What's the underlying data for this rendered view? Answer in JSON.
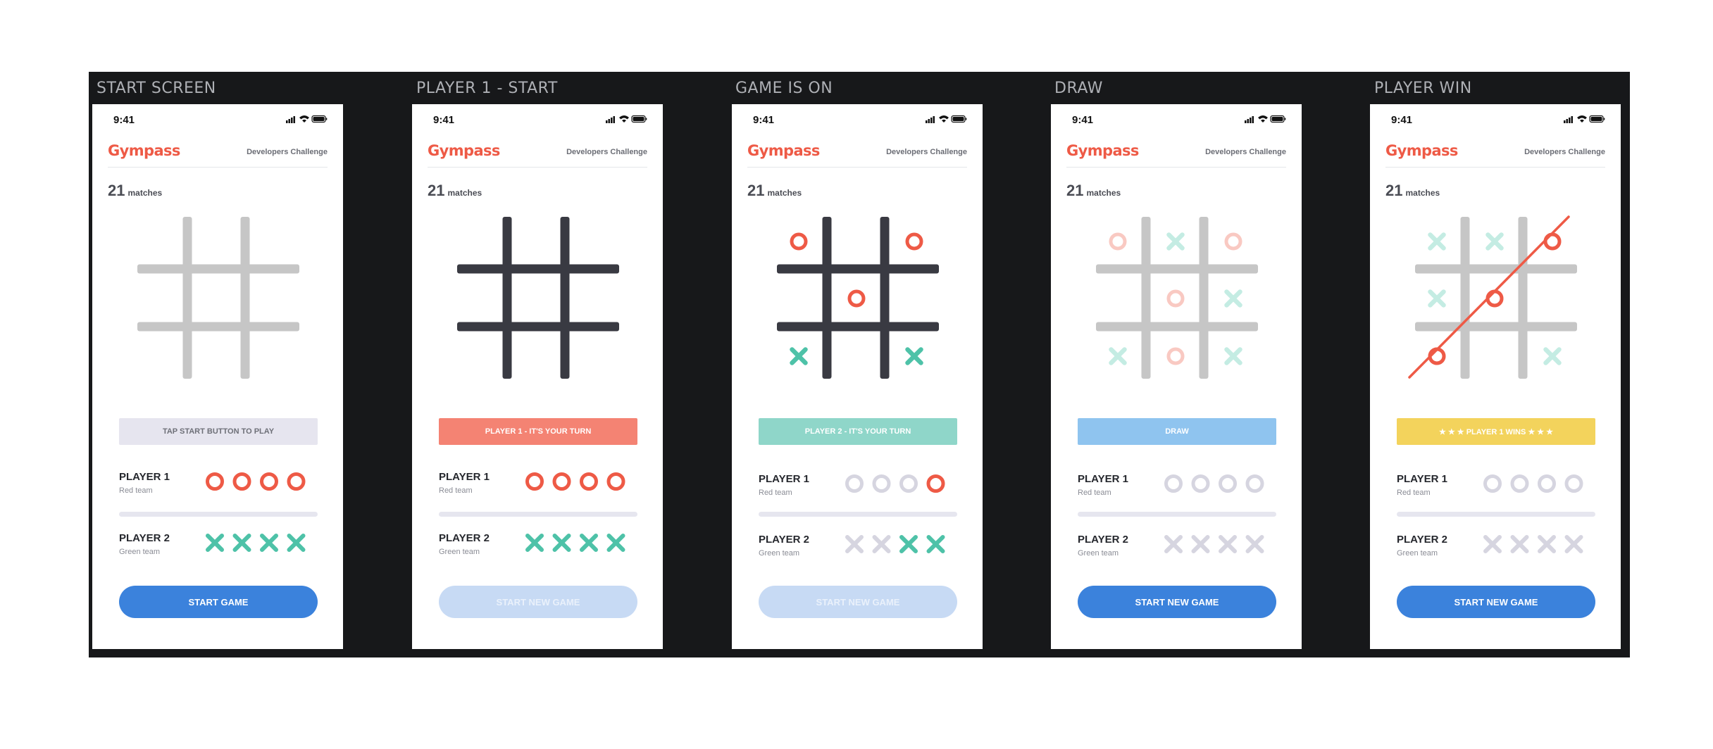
{
  "colors": {
    "background": "#ffffff",
    "board": "#17181a",
    "red": "#ee5a46",
    "red_faded": "#f9c9c2",
    "green": "#4ec2a8",
    "green_faded": "#c4ece3",
    "grid_light": "#c6c6c6",
    "grid_dark": "#393a42",
    "token_inactive": "#d6d5e0"
  },
  "screens": [
    {
      "title": "START SCREEN",
      "status_time": "9:41",
      "logo": "Gympass",
      "header_right": "Developers Challenge",
      "matches_count": "21",
      "matches_label": "matches",
      "grid_style": "light",
      "board": [
        [
          "",
          "",
          ""
        ],
        [
          "",
          "",
          ""
        ],
        [
          "",
          "",
          ""
        ]
      ],
      "win_line": false,
      "banner": {
        "text": "TAP START BUTTON TO PLAY",
        "bg": "#e6e5ef",
        "color": "#6e7078"
      },
      "player1": {
        "name": "PLAYER 1",
        "team": "Red team",
        "tokens_active": [
          true,
          true,
          true,
          true
        ]
      },
      "player2": {
        "name": "PLAYER 2",
        "team": "Green team",
        "tokens_active": [
          true,
          true,
          true,
          true
        ]
      },
      "button": {
        "label": "START GAME",
        "bg": "#3b82dc",
        "color": "#ffffff"
      }
    },
    {
      "title": "PLAYER 1 - START",
      "status_time": "9:41",
      "logo": "Gympass",
      "header_right": "Developers Challenge",
      "matches_count": "21",
      "matches_label": "matches",
      "grid_style": "dark",
      "board": [
        [
          "",
          "",
          ""
        ],
        [
          "",
          "",
          ""
        ],
        [
          "",
          "",
          ""
        ]
      ],
      "win_line": false,
      "banner": {
        "text": "PLAYER 1 - IT'S YOUR TURN",
        "bg": "#f48373",
        "color": "#ffffff"
      },
      "player1": {
        "name": "PLAYER 1",
        "team": "Red team",
        "tokens_active": [
          true,
          true,
          true,
          true
        ]
      },
      "player2": {
        "name": "PLAYER 2",
        "team": "Green team",
        "tokens_active": [
          true,
          true,
          true,
          true
        ]
      },
      "button": {
        "label": "START NEW GAME",
        "bg": "#c7daf4",
        "color": "#eaf1fb"
      }
    },
    {
      "title": "GAME IS ON",
      "status_time": "9:41",
      "logo": "Gympass",
      "header_right": "Developers Challenge",
      "matches_count": "21",
      "matches_label": "matches",
      "grid_style": "dark",
      "board": [
        [
          "O",
          "",
          "O"
        ],
        [
          "",
          "O",
          ""
        ],
        [
          "X",
          "",
          "X"
        ]
      ],
      "win_line": false,
      "banner": {
        "text": "PLAYER 2 - IT'S YOUR TURN",
        "bg": "#8fd6c9",
        "color": "#ffffff"
      },
      "player1": {
        "name": "PLAYER 1",
        "team": "Red team",
        "tokens_active": [
          false,
          false,
          false,
          true
        ]
      },
      "player2": {
        "name": "PLAYER 2",
        "team": "Green team",
        "tokens_active": [
          false,
          false,
          true,
          true
        ]
      },
      "button": {
        "label": "START NEW GAME",
        "bg": "#c7daf4",
        "color": "#eaf1fb"
      }
    },
    {
      "title": "DRAW",
      "status_time": "9:41",
      "logo": "Gympass",
      "header_right": "Developers Challenge",
      "matches_count": "21",
      "matches_label": "matches",
      "grid_style": "light",
      "board": [
        [
          "O",
          "X",
          "O"
        ],
        [
          "",
          "O",
          "X"
        ],
        [
          "X",
          "O",
          "X"
        ]
      ],
      "win_line": false,
      "banner": {
        "text": "DRAW",
        "bg": "#8fc4ef",
        "color": "#ffffff"
      },
      "player1": {
        "name": "PLAYER 1",
        "team": "Red team",
        "tokens_active": [
          false,
          false,
          false,
          false
        ]
      },
      "player2": {
        "name": "PLAYER 2",
        "team": "Green team",
        "tokens_active": [
          false,
          false,
          false,
          false
        ]
      },
      "button": {
        "label": "START NEW GAME",
        "bg": "#3b82dc",
        "color": "#ffffff"
      }
    },
    {
      "title": "PLAYER WIN",
      "status_time": "9:41",
      "logo": "Gympass",
      "header_right": "Developers Challenge",
      "matches_count": "21",
      "matches_label": "matches",
      "grid_style": "light",
      "board": [
        [
          "X",
          "X",
          "O"
        ],
        [
          "X",
          "O",
          ""
        ],
        [
          "O",
          "",
          "X"
        ]
      ],
      "win_line": true,
      "banner": {
        "text": "★ ★ ★   PLAYER 1 WINS   ★ ★ ★",
        "bg": "#f3d35c",
        "color": "#ffffff"
      },
      "player1": {
        "name": "PLAYER 1",
        "team": "Red team",
        "tokens_active": [
          false,
          false,
          false,
          false
        ]
      },
      "player2": {
        "name": "PLAYER 2",
        "team": "Green team",
        "tokens_active": [
          false,
          false,
          false,
          false
        ]
      },
      "button": {
        "label": "START NEW GAME",
        "bg": "#3b82dc",
        "color": "#ffffff"
      }
    }
  ]
}
